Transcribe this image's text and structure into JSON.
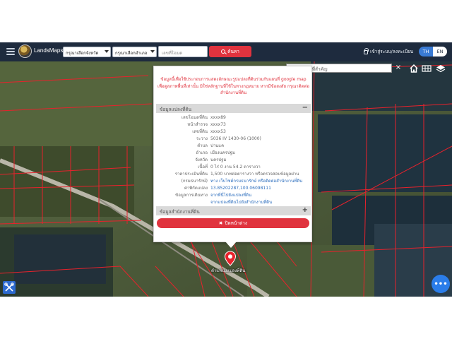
{
  "header": {
    "brand": "LandsMaps",
    "province_select": "กรุณาเลือกจังหวัด",
    "district_select": "กรุณาเลือกอำเภอ",
    "parcel_input_placeholder": "เลขที่โฉนด",
    "search_button": "ค้นหา",
    "login_link": "เข้าสู่ระบบ/ลงทะเบียน",
    "lang_th": "TH",
    "lang_en": "EN"
  },
  "map_tools": {
    "place_search_placeholder": "ค้นหาสถานที่สำคัญ",
    "clear": "×"
  },
  "popup": {
    "notice": "ข้อมูลนี้เพื่อใช้ประกอบการแสดงลักษณะรูปแปลงที่ดินร่วมกับแผนที่ google map เพื่อดูสภาพพื้นที่เท่านั้น มิใช่หลักฐานที่ใช้ในทางกฎหมาย หากมีข้อสงสัย กรุณาติดต่อสำนักงานที่ดิน",
    "section_parcel": "ข้อมูลแปลงที่ดิน",
    "section_parcel_toggle": "−",
    "rows": [
      {
        "label": "เลขโฉนดที่ดิน",
        "value": "xxxx89"
      },
      {
        "label": "หน้าสำรวจ",
        "value": "xxxx73"
      },
      {
        "label": "เลขที่ดิน",
        "value": "xxxx53"
      },
      {
        "label": "ระวาง",
        "value": "5036 IV 1430-06 (1000)"
      },
      {
        "label": "ตำบล",
        "value": "บ่านแค"
      },
      {
        "label": "อำเภอ",
        "value": "เมืองนครปฐม"
      },
      {
        "label": "จังหวัด",
        "value": "นครปฐม"
      },
      {
        "label": "เนื้อที่",
        "value": "0 ไร่ 0 งาน 54.2 ตารางวา"
      },
      {
        "label": "ราคาประเมินที่ดิน",
        "value": "1,500 บาทต่อตารางวา หรือตรวจสอบข้อมูลผ่าน"
      },
      {
        "label": "(กรมธนารักษ์)",
        "value": "ทาง เว็บไซต์กรมธนารักษ์ หรือติดต่อสำนักงานที่ดิน",
        "link": true
      },
      {
        "label": "ค่าพิกัดแปลง",
        "value": "13.85202287,100.06098111",
        "link": true
      },
      {
        "label": "ข้อมูลการเดินทาง",
        "value": "จากที่นี่ไปยังแปลงที่ดิน",
        "link": true
      },
      {
        "label": "",
        "value": "จากแปลงที่ดินไปยังสำนักงานที่ดิน",
        "link": true
      }
    ],
    "section_office": "ข้อมูลสำนักงานที่ดิน",
    "section_office_toggle": "+",
    "close_button": "ปิดหน้าต่าง",
    "close_icon": "✖"
  },
  "marker": {
    "label": "ตำแหน่งแปลงที่ดิน"
  },
  "colors": {
    "header_bg": "#1e2b3e",
    "accent_red": "#e0333e",
    "lang_active": "#3a7bd5",
    "parcel_line": "#e8222c",
    "link": "#2e6fbe"
  }
}
